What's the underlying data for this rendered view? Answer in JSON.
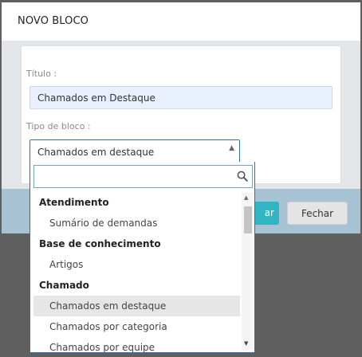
{
  "modal": {
    "title": "NOVO BLOCO",
    "fields": {
      "titulo_label": "Título :",
      "titulo_value": "Chamados em Destaque",
      "tipo_label": "Tipo de bloco :",
      "tipo_value": "Chamados em destaque"
    },
    "footer": {
      "primary_label": "ar",
      "close_label": "Fechar"
    }
  },
  "dropdown": {
    "search_placeholder": "",
    "items": [
      {
        "type": "group",
        "label": "Atendimento"
      },
      {
        "type": "option",
        "label": "Sumário de demandas"
      },
      {
        "type": "group",
        "label": "Base de conhecimento"
      },
      {
        "type": "option",
        "label": "Artigos"
      },
      {
        "type": "group",
        "label": "Chamado"
      },
      {
        "type": "option",
        "label": "Chamados em destaque",
        "selected": true
      },
      {
        "type": "option",
        "label": "Chamados por categoria"
      },
      {
        "type": "option",
        "label": "Chamados por equipe"
      }
    ]
  },
  "icons": {
    "search": "search-icon",
    "select_arrow": "caret-up-icon",
    "scroll_up": "scroll-up-icon",
    "scroll_down": "scroll-down-icon"
  },
  "colors": {
    "primary_button": "#2fb5c3",
    "footer_bg": "#a6c2d3",
    "focus_border": "#2b6fb7",
    "selected_item": "#e6e6e6"
  }
}
